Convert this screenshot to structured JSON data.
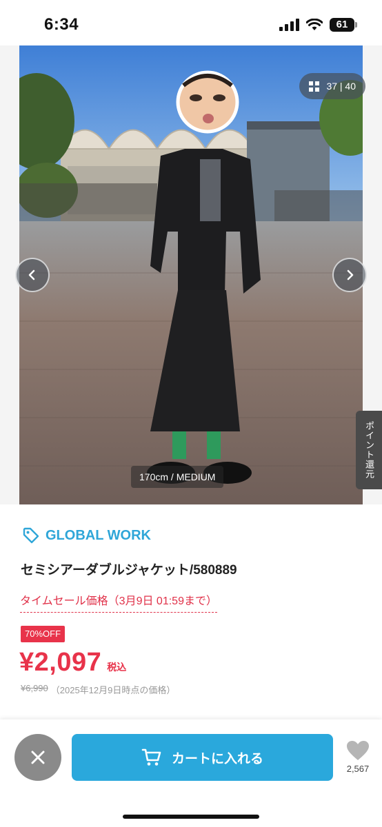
{
  "status_bar": {
    "time": "6:34",
    "battery": "61",
    "icons": [
      "signal-icon",
      "wifi-icon",
      "battery-icon"
    ]
  },
  "gallery": {
    "counter": "37 | 40",
    "size_label": "170cm / MEDIUM",
    "points_tab": "ポイント還元",
    "icons": [
      "grid-icon",
      "chevron-left-icon",
      "chevron-right-icon"
    ]
  },
  "product": {
    "brand": "GLOBAL WORK",
    "title": "セミシアーダブルジャケット/580889",
    "sale_label": "タイムセール価格（3月9日 01:59まで）",
    "discount_badge": "70%OFF",
    "price": "¥2,097",
    "tax_label": "税込",
    "original_price": "¥6,990",
    "original_price_note": "（2025年12月9日時点の価格）"
  },
  "bottom_bar": {
    "cart_label": "カートに入れる",
    "like_count": "2,567",
    "icons": [
      "close-icon",
      "cart-icon",
      "heart-icon"
    ]
  },
  "colors": {
    "accent_blue": "#2aa8dc",
    "brand_blue": "#2fa6d8",
    "sale_red": "#e8334a",
    "close_gray": "#8a8a8a"
  }
}
